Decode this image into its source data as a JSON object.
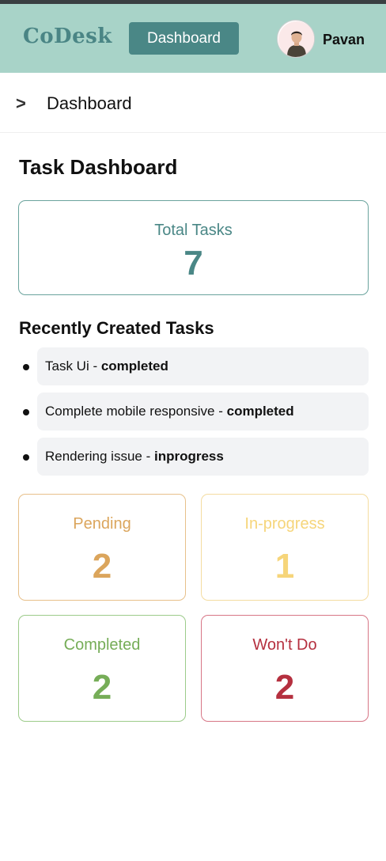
{
  "header": {
    "logo": "CoDesk",
    "nav_button": "Dashboard",
    "username": "Pavan"
  },
  "breadcrumb": {
    "chevron": ">",
    "current": "Dashboard"
  },
  "page": {
    "title": "Task Dashboard"
  },
  "total": {
    "label": "Total Tasks",
    "value": "7"
  },
  "recent": {
    "title": "Recently Created Tasks",
    "items": [
      {
        "name": "Task Ui",
        "separator": " - ",
        "status": "completed"
      },
      {
        "name": "Complete mobile responsive",
        "separator": " - ",
        "status": "completed"
      },
      {
        "name": "Rendering issue",
        "separator": " - ",
        "status": "inprogress"
      }
    ]
  },
  "stats": {
    "pending": {
      "label": "Pending",
      "value": "2",
      "color": "#dba55c"
    },
    "inprogress": {
      "label": "In-progress",
      "value": "1",
      "color": "#f6d57a"
    },
    "completed": {
      "label": "Completed",
      "value": "2",
      "color": "#76ad58"
    },
    "wontdo": {
      "label": "Won't Do",
      "value": "2",
      "color": "#b5303f"
    }
  },
  "colors": {
    "header_bg": "#a8d3c8",
    "accent": "#4a8786"
  },
  "icons": {
    "avatar": "user-avatar-icon"
  }
}
